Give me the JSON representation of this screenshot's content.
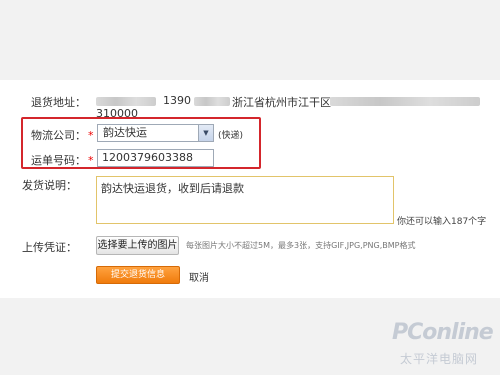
{
  "form": {
    "return_address": {
      "label": "退货地址：",
      "phone": "1390",
      "location": "浙江省杭州市江干区",
      "zip": "310000"
    },
    "courier": {
      "label": "物流公司：",
      "required": "*",
      "selected": "韵达快运",
      "hint": "(快递)"
    },
    "tracking": {
      "label": "运单号码：",
      "required": "*",
      "value": "1200379603388"
    },
    "note": {
      "label": "发货说明：",
      "value": "韵达快运退货，收到后请退款",
      "counter": "你还可以输入187个字"
    },
    "upload": {
      "label": "上传凭证：",
      "button": "选择要上传的图片",
      "tip": "每张图片大小不超过5M，最多3张，支持GIF,JPG,PNG,BMP格式"
    },
    "actions": {
      "submit": "提交退货信息",
      "cancel": "取消"
    }
  },
  "watermark": {
    "brand": "PConline",
    "sub": "太平洋电脑网"
  }
}
